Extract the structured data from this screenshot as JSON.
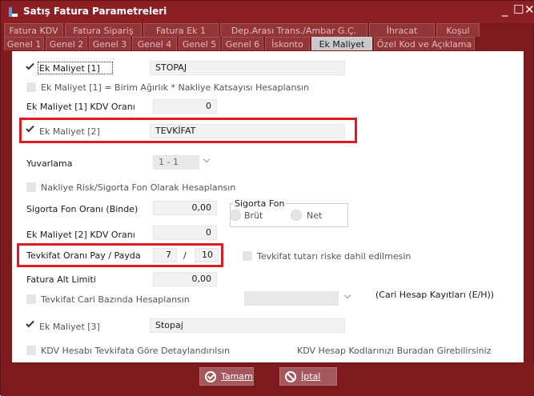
{
  "window": {
    "title": "Satış Fatura Parametreleri",
    "minimize": "_",
    "maximize": "☐",
    "close": "✕"
  },
  "tabs_row1": [
    "Fatura KDV",
    "Fatura Sipariş",
    "Fatura Ek 1",
    "Dep.Arası Trans./Ambar G.Ç.",
    "İhracat",
    "Koşul"
  ],
  "tabs_row2": [
    "Genel 1",
    "Genel 2",
    "Genel 3",
    "Genel 4",
    "Genel 5",
    "Genel 6",
    "İskonto",
    "Ek Maliyet",
    "Özel Kod ve Açıklama"
  ],
  "active_tab": "Ek Maliyet",
  "form": {
    "ek_maliyet_1": {
      "label": "Ek Maliyet [1]",
      "checked": true,
      "value": "STOPAJ"
    },
    "birim_agirlik": {
      "label": "Ek Maliyet [1] = Birim Ağırlık * Nakliye Katsayısı Hesaplansın",
      "checked": false
    },
    "ek_maliyet_1_kdv": {
      "label": "Ek Maliyet [1] KDV Oranı",
      "value": "0"
    },
    "ek_maliyet_2": {
      "label": "Ek Maliyet [2]",
      "checked": true,
      "value": "TEVKİFAT"
    },
    "yuvarlama": {
      "label": "Yuvarlama",
      "value": "1 - 1"
    },
    "nakliye_risk": {
      "label": "Nakliye Risk/Sigorta Fon Olarak Hesaplansın",
      "checked": false
    },
    "sigorta_fon_orani": {
      "label": "Sigorta Fon Oranı (Binde)",
      "value": "0,00"
    },
    "sigorta_fon": {
      "title": "Sigorta Fon",
      "option1": "Brüt",
      "option2": "Net"
    },
    "ek_maliyet_2_kdv": {
      "label": "Ek Maliyet [2] KDV Oranı",
      "value": "0"
    },
    "tevkifat_orani": {
      "label": "Tevkifat Oranı Pay / Payda",
      "pay": "7",
      "sep": "/",
      "payda": "10"
    },
    "tevkifat_riske": {
      "label": "Tevkifat tutarı riske dahil edilmesin",
      "checked": false
    },
    "fatura_alt_limiti": {
      "label": "Fatura Alt Limiti",
      "value": "0,00"
    },
    "tevkifat_cari": {
      "label": "Tevkifat Cari Bazında Hesaplansın",
      "checked": false
    },
    "cari_hesap": {
      "label": "(Cari Hesap Kayıtları (E/H))"
    },
    "ek_maliyet_3": {
      "label": "Ek Maliyet [3]",
      "checked": true,
      "value": "Stopaj"
    },
    "kdv_hesabi": {
      "label": "KDV Hesabı Tevkifata Göre Detaylandırılsın",
      "checked": false
    },
    "kdv_hesap_kodlari": {
      "label": "KDV Hesap Kodlarınızı Buradan Girebilirsiniz"
    }
  },
  "buttons": {
    "ok_label": "Tamam",
    "cancel_label": "İptal"
  },
  "colors": {
    "frame": "#7d1a1e",
    "highlight": "#e11b22",
    "active_tab": "#c9c9c9"
  }
}
